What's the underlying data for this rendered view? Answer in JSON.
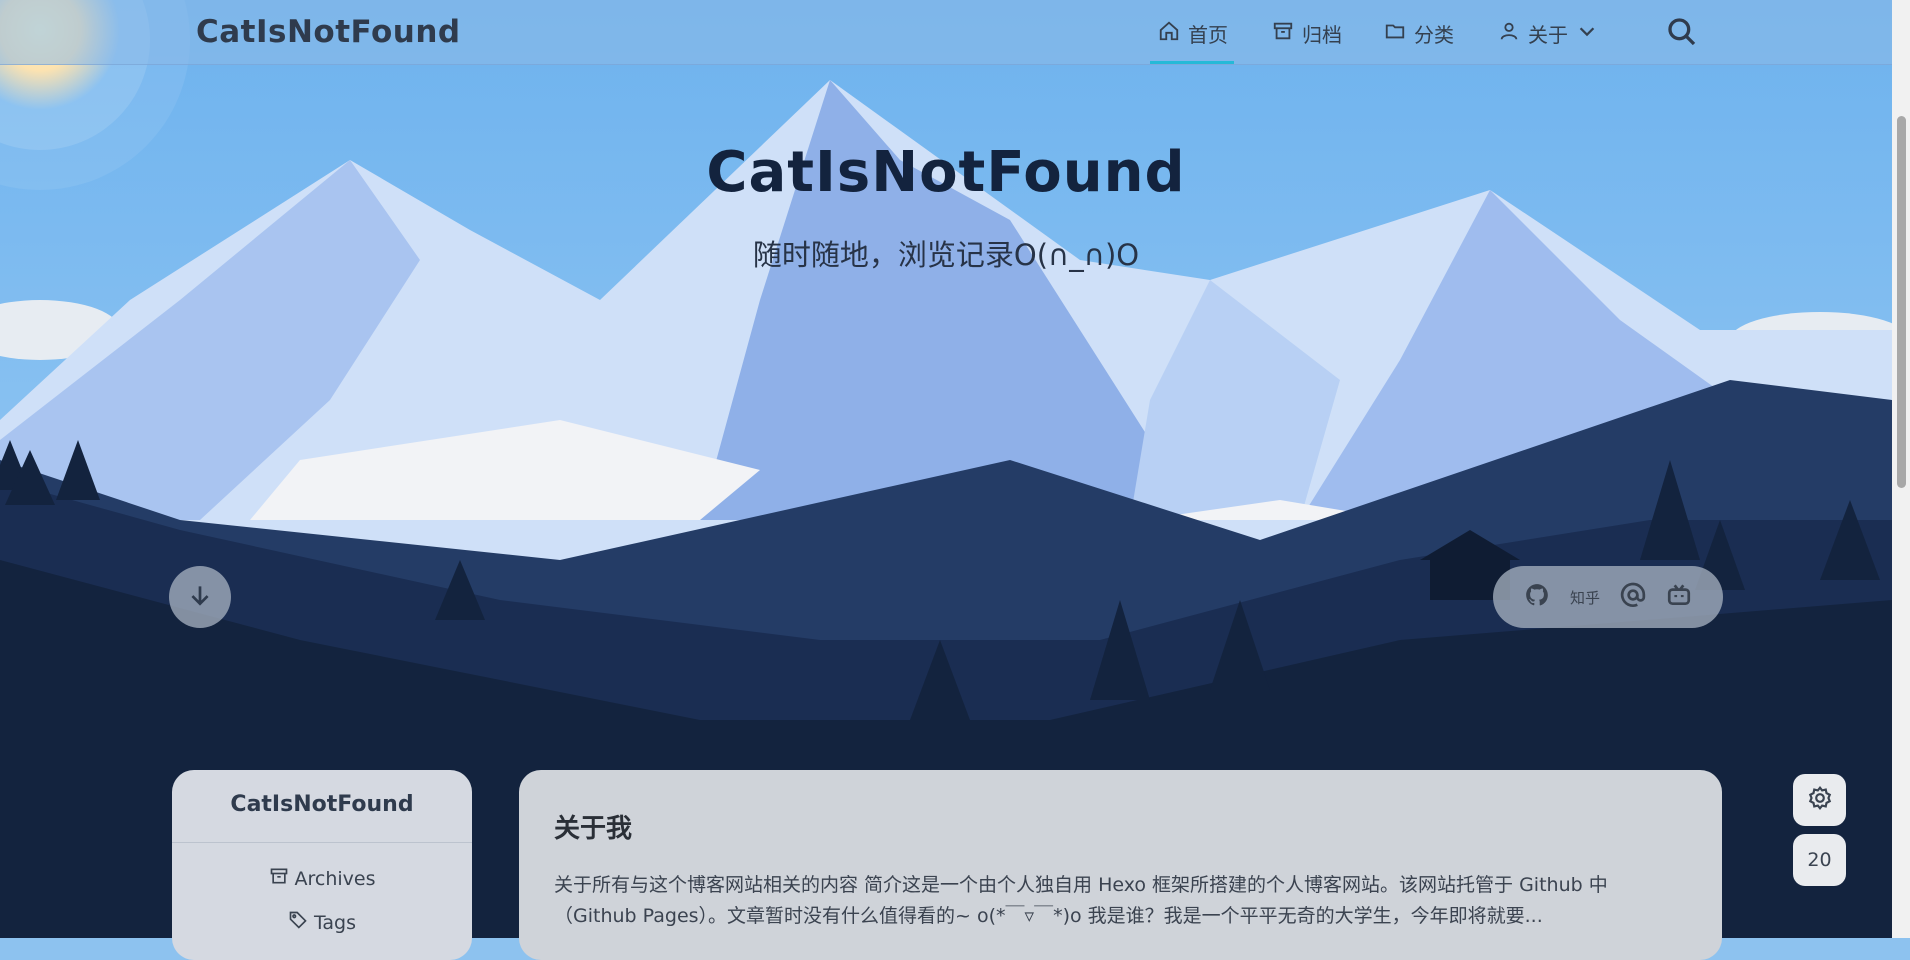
{
  "header": {
    "brand": "CatIsNotFound",
    "nav": [
      {
        "label": "首页",
        "icon": "home-icon",
        "active": true
      },
      {
        "label": "归档",
        "icon": "archive-icon",
        "active": false
      },
      {
        "label": "分类",
        "icon": "folder-icon",
        "active": false
      },
      {
        "label": "关于",
        "icon": "user-icon",
        "active": false
      }
    ]
  },
  "hero": {
    "title": "CatIsNotFound",
    "subtitle": "随时随地，浏览记录O(∩_∩)O"
  },
  "social": {
    "zhihu_label": "知乎"
  },
  "side_widgets": {
    "counter": "20"
  },
  "profile": {
    "name": "CatIsNotFound",
    "links": [
      {
        "label": "Archives",
        "icon": "archive-icon"
      },
      {
        "label": "Tags",
        "icon": "tag-icon"
      }
    ]
  },
  "about": {
    "title": "关于我",
    "text": "关于所有与这个博客网站相关的内容 简介这是一个由个人独自用 Hexo 框架所搭建的个人博客网站。该网站托管于 Github 中（Github Pages）。文章暂时没有什么值得看的~ o(*￣▿￣*)o 我是谁？我是一个平平无奇的大学生，今年即将就要..."
  },
  "colors": {
    "accent": "#25b9d8",
    "sky": "#8dc2ef",
    "dark_mountain": "#13233e"
  }
}
